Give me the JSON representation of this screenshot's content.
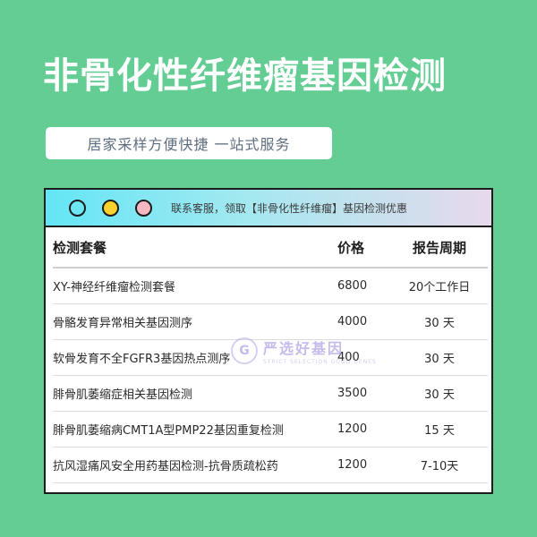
{
  "title": "非骨化性纤维瘤基因检测",
  "subtitle": "居家采样方便快捷 一站式服务",
  "card": {
    "header_text": "联系客服，领取【非骨化性纤维瘤】基因检测优惠",
    "window_dots": [
      "cyan",
      "yellow",
      "pink"
    ],
    "colors": {
      "dot_cyan": "#6ce7f3",
      "dot_yellow": "#f9d12c",
      "dot_pink": "#f7b7c0"
    }
  },
  "table": {
    "headers": [
      "检测套餐",
      "价格",
      "报告周期"
    ],
    "rows": [
      {
        "name": "XY-神经纤维瘤检测套餐",
        "price": "6800",
        "period": "20个工作日"
      },
      {
        "name": "骨骼发育异常相关基因测序",
        "price": "4000",
        "period": "30 天"
      },
      {
        "name": "软骨发育不全FGFR3基因热点测序",
        "price": "400",
        "period": "30 天"
      },
      {
        "name": "腓骨肌萎缩症相关基因检测",
        "price": "3500",
        "period": "30 天"
      },
      {
        "name": "腓骨肌萎缩病CMT1A型PMP22基因重复检测",
        "price": "1200",
        "period": "15 天"
      },
      {
        "name": "抗风湿痛风安全用药基因检测-抗骨质疏松药",
        "price": "1200",
        "period": "7-10天"
      }
    ]
  },
  "watermark": {
    "text": "严选好基因",
    "subtext": "STRICT SELECTION GOOD GENES"
  },
  "colors": {
    "background": "#63cd94",
    "title": "#ffffff",
    "header_gradient": [
      "#63e6f5",
      "#e7d9ec"
    ]
  }
}
